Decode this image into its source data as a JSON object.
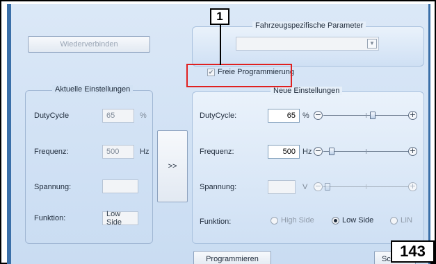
{
  "left": {
    "reconnect_label": "Wiederverbinden",
    "current_settings": {
      "title": "Aktuelle Einstellungen",
      "dutycycle": {
        "label": "DutyCycle",
        "value": "65",
        "unit": "%"
      },
      "frequency": {
        "label": "Frequenz:",
        "value": "500",
        "unit": "Hz"
      },
      "voltage": {
        "label": "Spannung:",
        "value": ""
      },
      "function": {
        "label": "Funktion:",
        "value": "Low Side"
      }
    }
  },
  "transfer_label": ">>",
  "vehicle_params": {
    "title": "Fahrzeugspezifische Parameter",
    "selected": ""
  },
  "free_programming": {
    "label": "Freie Programmierung",
    "checked": true
  },
  "new_settings": {
    "title": "Neue Einstellungen",
    "dutycycle": {
      "label": "DutyCycle:",
      "value": "65",
      "unit": "%"
    },
    "frequency": {
      "label": "Frequenz:",
      "value": "500",
      "unit": "Hz"
    },
    "voltage": {
      "label": "Spannung:",
      "value": "",
      "unit": "V"
    },
    "function": {
      "label": "Funktion:",
      "options": [
        "High Side",
        "Low Side",
        "LIN"
      ],
      "selected": "Low Side"
    }
  },
  "program_label": "Programmieren",
  "close_label_partial": "Sch",
  "callout_number": "1",
  "page_number": "143",
  "colors": {
    "accent_frame": "#3a6fa8",
    "callout_red": "#e02020"
  }
}
